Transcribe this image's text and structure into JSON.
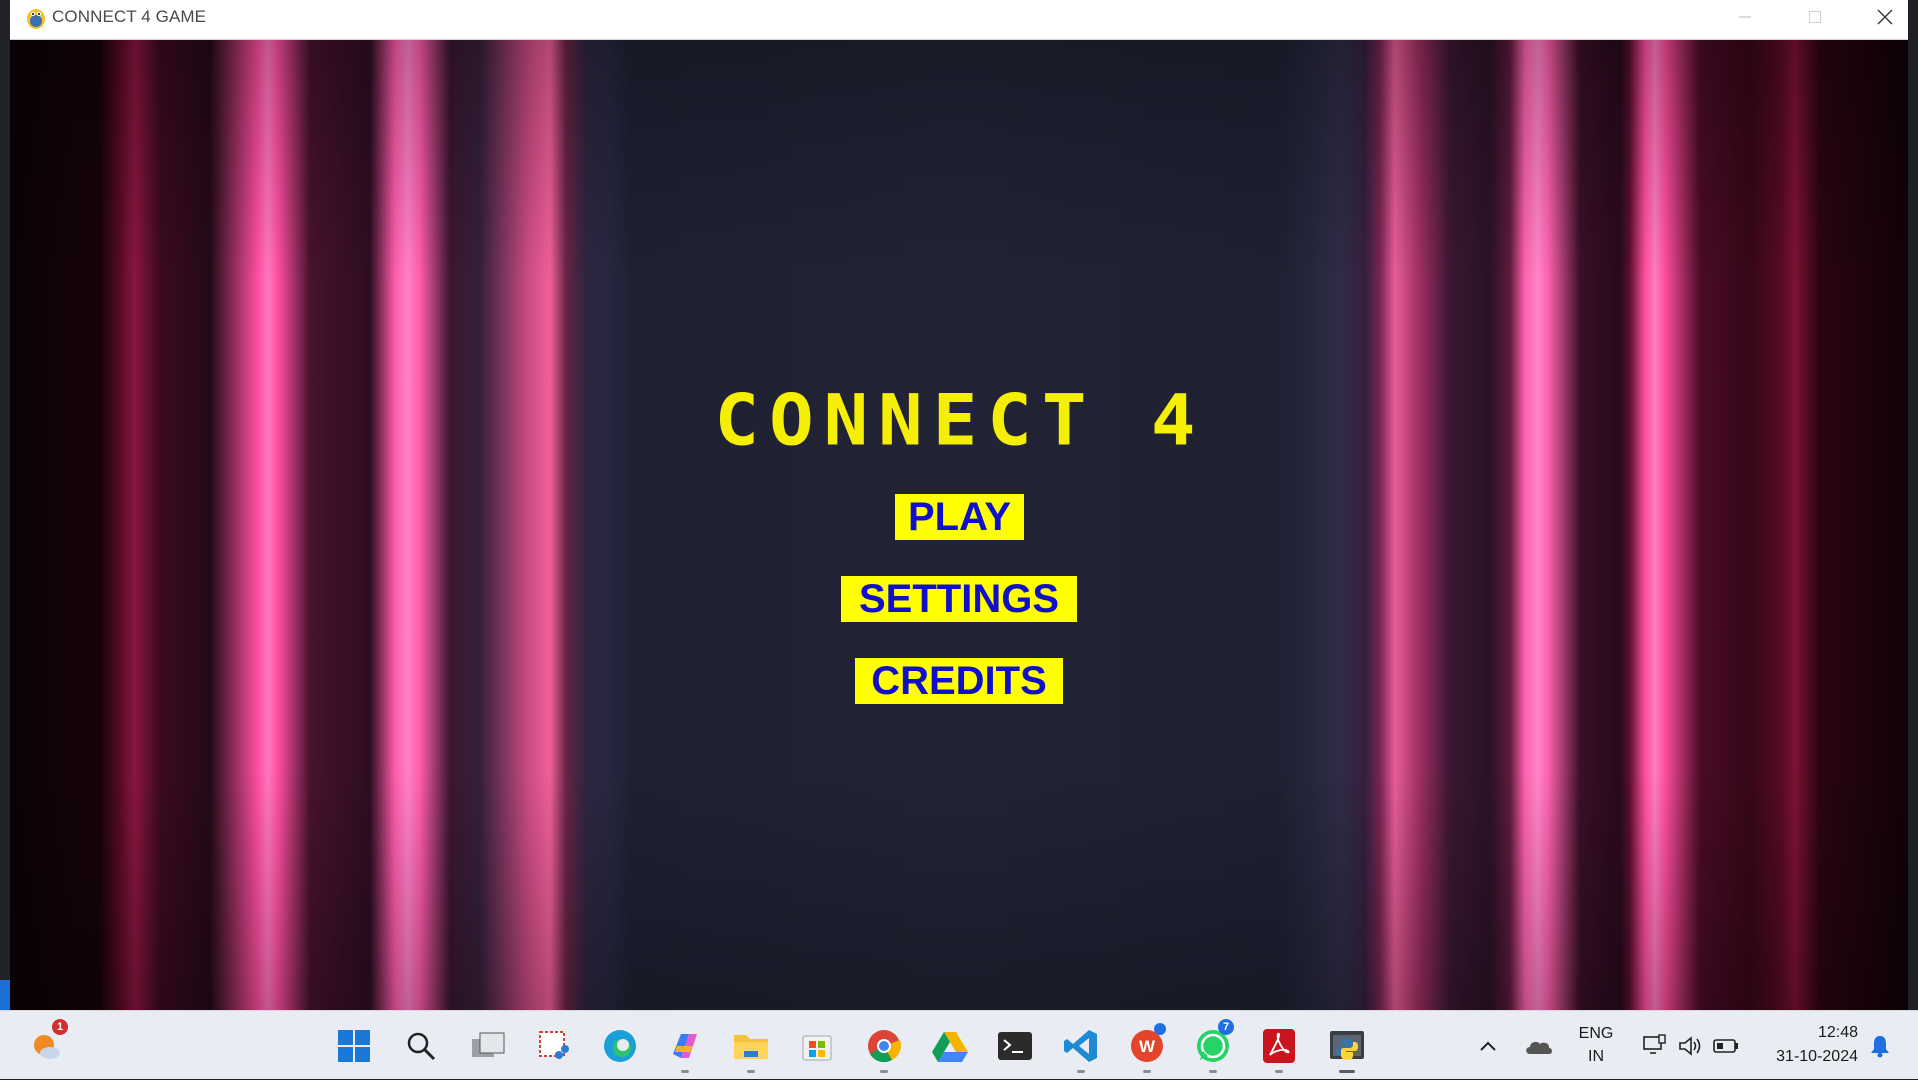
{
  "window": {
    "title": "CONNECT 4 GAME"
  },
  "game": {
    "title": "CONNECT 4",
    "menu": {
      "play": "PLAY",
      "settings": "SETTINGS",
      "credits": "CREDITS"
    }
  },
  "taskbar": {
    "weather_badge": "1",
    "pinned": [
      "start-icon",
      "search-icon",
      "task-view-icon",
      "snipping-tool-icon",
      "edge-icon",
      "copilot-icon",
      "file-explorer-icon",
      "microsoft-store-icon",
      "chrome-icon",
      "google-drive-icon",
      "terminal-icon",
      "vscode-icon",
      "wps-office-icon",
      "whatsapp-icon",
      "acrobat-icon",
      "python-icon"
    ],
    "whatsapp_badge": "7",
    "tray": {
      "lang_top": "ENG",
      "lang_bottom": "IN",
      "time": "12:48",
      "date": "31-10-2024"
    }
  },
  "colors": {
    "title_yellow": "#f4ef04",
    "button_yellow": "#ffff00",
    "button_text_blue": "#1010c8",
    "curtain_pink": "#ff78c0"
  }
}
